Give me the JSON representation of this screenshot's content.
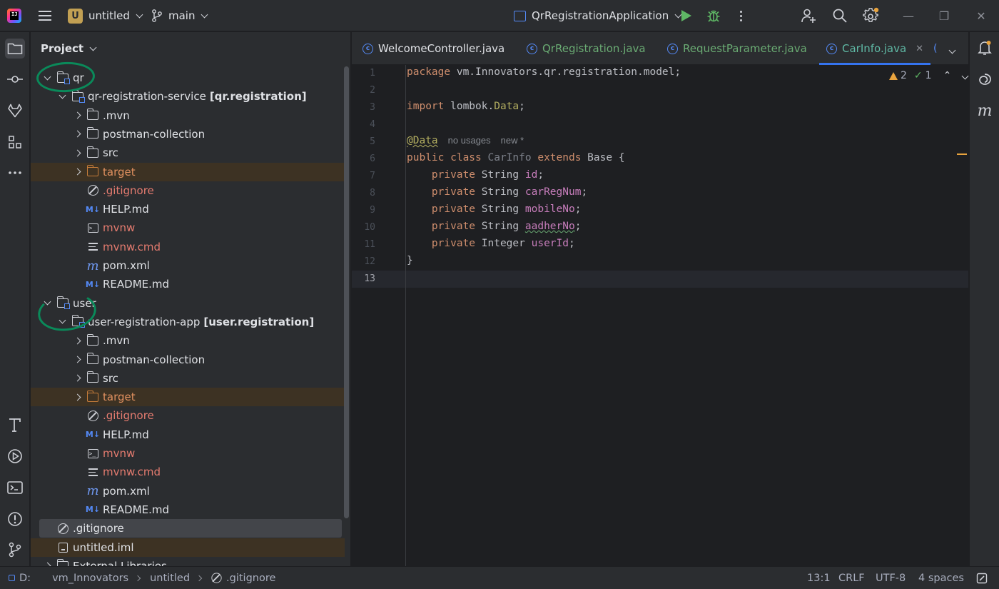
{
  "titlebar": {
    "project_badge": "U",
    "project_name": "untitled",
    "branch": "main",
    "run_config": "QrRegistrationApplication"
  },
  "project_panel": {
    "title": "Project",
    "tree": [
      {
        "label": "qr",
        "kind": "module-folder",
        "expanded": true
      },
      {
        "label": "qr-registration-service",
        "suffix": "[qr.registration]",
        "kind": "module",
        "expanded": true
      },
      {
        "label": ".mvn",
        "kind": "folder"
      },
      {
        "label": "postman-collection",
        "kind": "folder"
      },
      {
        "label": "src",
        "kind": "folder"
      },
      {
        "label": "target",
        "kind": "excluded-folder"
      },
      {
        "label": ".gitignore",
        "kind": "ignore"
      },
      {
        "label": "HELP.md",
        "kind": "markdown"
      },
      {
        "label": "mvnw",
        "kind": "shell"
      },
      {
        "label": "mvnw.cmd",
        "kind": "text"
      },
      {
        "label": "pom.xml",
        "kind": "maven"
      },
      {
        "label": "README.md",
        "kind": "markdown"
      },
      {
        "label": "user",
        "kind": "module-folder",
        "expanded": true
      },
      {
        "label": "user-registration-app",
        "suffix": "[user.registration]",
        "kind": "module",
        "expanded": true
      },
      {
        "label": ".mvn",
        "kind": "folder"
      },
      {
        "label": "postman-collection",
        "kind": "folder"
      },
      {
        "label": "src",
        "kind": "folder"
      },
      {
        "label": "target",
        "kind": "excluded-folder"
      },
      {
        "label": ".gitignore",
        "kind": "ignore"
      },
      {
        "label": "HELP.md",
        "kind": "markdown"
      },
      {
        "label": "mvnw",
        "kind": "shell"
      },
      {
        "label": "mvnw.cmd",
        "kind": "text"
      },
      {
        "label": "pom.xml",
        "kind": "maven"
      },
      {
        "label": "README.md",
        "kind": "markdown"
      },
      {
        "label": ".gitignore",
        "kind": "ignore-root"
      },
      {
        "label": "untitled.iml",
        "kind": "iml"
      },
      {
        "label": "External Libraries",
        "kind": "libs"
      }
    ]
  },
  "editor": {
    "tabs": [
      {
        "label": "WelcomeController.java"
      },
      {
        "label": "QrRegistration.java"
      },
      {
        "label": "RequestParameter.java"
      },
      {
        "label": "CarInfo.java"
      }
    ],
    "inspections": {
      "warnings": "2",
      "ok": "1"
    },
    "line_numbers": [
      "1",
      "2",
      "3",
      "4",
      "5",
      "6",
      "7",
      "8",
      "9",
      "10",
      "11",
      "12",
      "13"
    ],
    "code": {
      "l1_kw": "package",
      "l1_rest": " vm.Innovators.qr.registration.model;",
      "l3_kw": "import",
      "l3_pkg": " lombok.",
      "l3_cls": "Data",
      "l3_end": ";",
      "l5_ann": "@Data",
      "l5_hint1": "no usages",
      "l5_hint2": "new *",
      "l6_kw": "public class",
      "l6_name": " CarInfo",
      "l6_kw2": " extends",
      "l6_rest": " Base {",
      "field_kw": "private",
      "f1_type": " String ",
      "f1_name": "id",
      "f2_type": " String ",
      "f2_name": "carRegNum",
      "f3_type": " String ",
      "f3_name": "mobileNo",
      "f4_type": " String ",
      "f4_name": "aadherNo",
      "f5_type": " Integer ",
      "f5_name": "userId",
      "semi": ";",
      "l12": "}"
    }
  },
  "statusbar": {
    "crumbs": [
      "D:",
      "vm_Innovators",
      "untitled",
      ".gitignore"
    ],
    "position": "13:1",
    "line_sep": "CRLF",
    "encoding": "UTF-8",
    "indent": "4 spaces"
  }
}
